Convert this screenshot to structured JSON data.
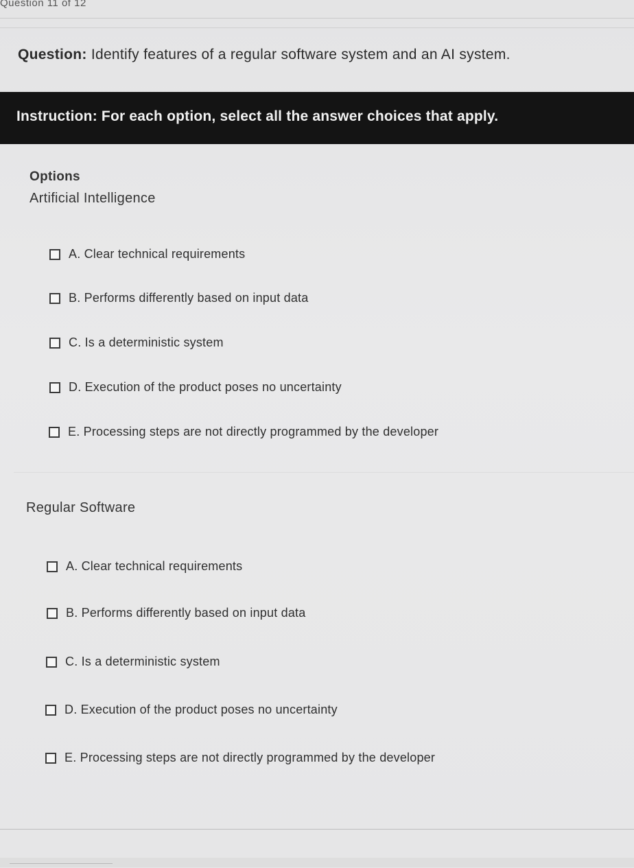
{
  "header": {
    "progress_text": "Question 11 of 12"
  },
  "question": {
    "label": "Question:",
    "text": " Identify features of a regular software system and an AI system."
  },
  "instruction": {
    "text": "Instruction: For each option, select all the answer choices that apply."
  },
  "options_heading": "Options",
  "groups": [
    {
      "title": "Artificial Intelligence",
      "choices": [
        {
          "label": "A. Clear technical requirements",
          "checked": false
        },
        {
          "label": "B. Performs differently based on input data",
          "checked": false
        },
        {
          "label": "C. Is a deterministic system",
          "checked": false
        },
        {
          "label": "D. Execution of the product poses no uncertainty",
          "checked": false
        },
        {
          "label": "E. Processing steps are not directly programmed by the developer",
          "checked": false
        }
      ]
    },
    {
      "title": "Regular Software",
      "choices": [
        {
          "label": "A. Clear technical requirements",
          "checked": false
        },
        {
          "label": "B. Performs differently based on input data",
          "checked": false
        },
        {
          "label": "C. Is a deterministic system",
          "checked": false
        },
        {
          "label": "D. Execution of the product poses no uncertainty",
          "checked": false
        },
        {
          "label": "E. Processing steps are not directly programmed by the developer",
          "checked": false
        }
      ]
    }
  ]
}
